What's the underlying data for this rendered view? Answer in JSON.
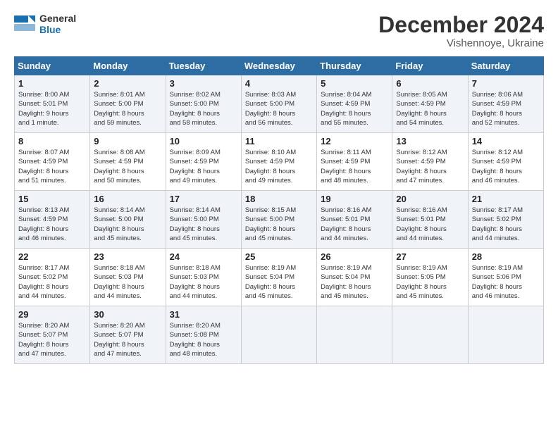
{
  "header": {
    "logo_line1": "General",
    "logo_line2": "Blue",
    "month": "December 2024",
    "location": "Vishennoye, Ukraine"
  },
  "days_of_week": [
    "Sunday",
    "Monday",
    "Tuesday",
    "Wednesday",
    "Thursday",
    "Friday",
    "Saturday"
  ],
  "weeks": [
    [
      {
        "day": "1",
        "info": "Sunrise: 8:00 AM\nSunset: 5:01 PM\nDaylight: 9 hours\nand 1 minute."
      },
      {
        "day": "2",
        "info": "Sunrise: 8:01 AM\nSunset: 5:00 PM\nDaylight: 8 hours\nand 59 minutes."
      },
      {
        "day": "3",
        "info": "Sunrise: 8:02 AM\nSunset: 5:00 PM\nDaylight: 8 hours\nand 58 minutes."
      },
      {
        "day": "4",
        "info": "Sunrise: 8:03 AM\nSunset: 5:00 PM\nDaylight: 8 hours\nand 56 minutes."
      },
      {
        "day": "5",
        "info": "Sunrise: 8:04 AM\nSunset: 4:59 PM\nDaylight: 8 hours\nand 55 minutes."
      },
      {
        "day": "6",
        "info": "Sunrise: 8:05 AM\nSunset: 4:59 PM\nDaylight: 8 hours\nand 54 minutes."
      },
      {
        "day": "7",
        "info": "Sunrise: 8:06 AM\nSunset: 4:59 PM\nDaylight: 8 hours\nand 52 minutes."
      }
    ],
    [
      {
        "day": "8",
        "info": "Sunrise: 8:07 AM\nSunset: 4:59 PM\nDaylight: 8 hours\nand 51 minutes."
      },
      {
        "day": "9",
        "info": "Sunrise: 8:08 AM\nSunset: 4:59 PM\nDaylight: 8 hours\nand 50 minutes."
      },
      {
        "day": "10",
        "info": "Sunrise: 8:09 AM\nSunset: 4:59 PM\nDaylight: 8 hours\nand 49 minutes."
      },
      {
        "day": "11",
        "info": "Sunrise: 8:10 AM\nSunset: 4:59 PM\nDaylight: 8 hours\nand 49 minutes."
      },
      {
        "day": "12",
        "info": "Sunrise: 8:11 AM\nSunset: 4:59 PM\nDaylight: 8 hours\nand 48 minutes."
      },
      {
        "day": "13",
        "info": "Sunrise: 8:12 AM\nSunset: 4:59 PM\nDaylight: 8 hours\nand 47 minutes."
      },
      {
        "day": "14",
        "info": "Sunrise: 8:12 AM\nSunset: 4:59 PM\nDaylight: 8 hours\nand 46 minutes."
      }
    ],
    [
      {
        "day": "15",
        "info": "Sunrise: 8:13 AM\nSunset: 4:59 PM\nDaylight: 8 hours\nand 46 minutes."
      },
      {
        "day": "16",
        "info": "Sunrise: 8:14 AM\nSunset: 5:00 PM\nDaylight: 8 hours\nand 45 minutes."
      },
      {
        "day": "17",
        "info": "Sunrise: 8:14 AM\nSunset: 5:00 PM\nDaylight: 8 hours\nand 45 minutes."
      },
      {
        "day": "18",
        "info": "Sunrise: 8:15 AM\nSunset: 5:00 PM\nDaylight: 8 hours\nand 45 minutes."
      },
      {
        "day": "19",
        "info": "Sunrise: 8:16 AM\nSunset: 5:01 PM\nDaylight: 8 hours\nand 44 minutes."
      },
      {
        "day": "20",
        "info": "Sunrise: 8:16 AM\nSunset: 5:01 PM\nDaylight: 8 hours\nand 44 minutes."
      },
      {
        "day": "21",
        "info": "Sunrise: 8:17 AM\nSunset: 5:02 PM\nDaylight: 8 hours\nand 44 minutes."
      }
    ],
    [
      {
        "day": "22",
        "info": "Sunrise: 8:17 AM\nSunset: 5:02 PM\nDaylight: 8 hours\nand 44 minutes."
      },
      {
        "day": "23",
        "info": "Sunrise: 8:18 AM\nSunset: 5:03 PM\nDaylight: 8 hours\nand 44 minutes."
      },
      {
        "day": "24",
        "info": "Sunrise: 8:18 AM\nSunset: 5:03 PM\nDaylight: 8 hours\nand 44 minutes."
      },
      {
        "day": "25",
        "info": "Sunrise: 8:19 AM\nSunset: 5:04 PM\nDaylight: 8 hours\nand 45 minutes."
      },
      {
        "day": "26",
        "info": "Sunrise: 8:19 AM\nSunset: 5:04 PM\nDaylight: 8 hours\nand 45 minutes."
      },
      {
        "day": "27",
        "info": "Sunrise: 8:19 AM\nSunset: 5:05 PM\nDaylight: 8 hours\nand 45 minutes."
      },
      {
        "day": "28",
        "info": "Sunrise: 8:19 AM\nSunset: 5:06 PM\nDaylight: 8 hours\nand 46 minutes."
      }
    ],
    [
      {
        "day": "29",
        "info": "Sunrise: 8:20 AM\nSunset: 5:07 PM\nDaylight: 8 hours\nand 47 minutes."
      },
      {
        "day": "30",
        "info": "Sunrise: 8:20 AM\nSunset: 5:07 PM\nDaylight: 8 hours\nand 47 minutes."
      },
      {
        "day": "31",
        "info": "Sunrise: 8:20 AM\nSunset: 5:08 PM\nDaylight: 8 hours\nand 48 minutes."
      },
      {
        "day": "",
        "info": ""
      },
      {
        "day": "",
        "info": ""
      },
      {
        "day": "",
        "info": ""
      },
      {
        "day": "",
        "info": ""
      }
    ]
  ]
}
